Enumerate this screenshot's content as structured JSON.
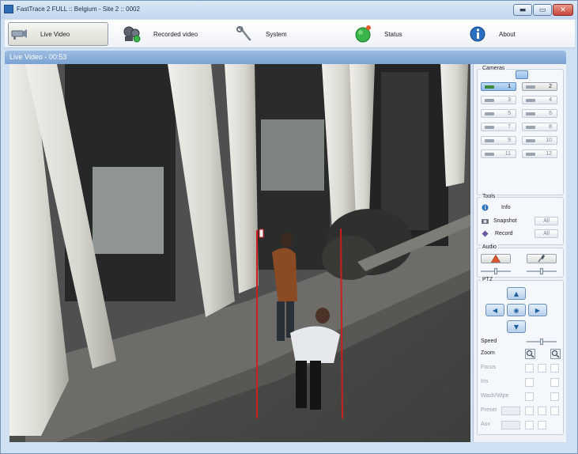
{
  "window": {
    "title": "FastTrace 2 FULL :: Belgium - Site 2 :: 0002",
    "buttons": {
      "minimize": "▬",
      "maximize": "▭",
      "close": "✕"
    }
  },
  "toolbar": {
    "live_video": "Live Video",
    "recorded_video": "Recorded video",
    "system": "System",
    "status": "Status",
    "about": "About"
  },
  "section": {
    "title": "Live Video - 00:53"
  },
  "cameras": {
    "title": "Cameras",
    "items": [
      {
        "label": "1",
        "state": "selected"
      },
      {
        "label": "2",
        "state": "connected"
      },
      {
        "label": "3",
        "state": "disabled"
      },
      {
        "label": "4",
        "state": "disabled"
      },
      {
        "label": "5",
        "state": "disabled"
      },
      {
        "label": "6",
        "state": "disabled"
      },
      {
        "label": "7",
        "state": "disabled"
      },
      {
        "label": "8",
        "state": "disabled"
      },
      {
        "label": "9",
        "state": "disabled"
      },
      {
        "label": "10",
        "state": "disabled"
      },
      {
        "label": "11",
        "state": "disabled"
      },
      {
        "label": "12",
        "state": "disabled"
      }
    ]
  },
  "tools": {
    "title": "Tools",
    "info": "Info",
    "snapshot": "Snapshot",
    "record": "Record",
    "all_label": "All"
  },
  "audio": {
    "title": "Audio"
  },
  "ptz": {
    "title": "PTZ",
    "speed": "Speed",
    "zoom": "Zoom",
    "focus": "Focus",
    "iris": "Iris",
    "wash_wipe": "Wash/Wipe",
    "preset": "Preset",
    "aux": "Aux",
    "arrows": {
      "up": "▲",
      "down": "▼",
      "left": "◀",
      "right": "▶",
      "center": "◉"
    }
  },
  "colors": {
    "accent": "#7aa2d2",
    "status_green": "#3bb54a",
    "zone_line": "#cc1f1f"
  }
}
